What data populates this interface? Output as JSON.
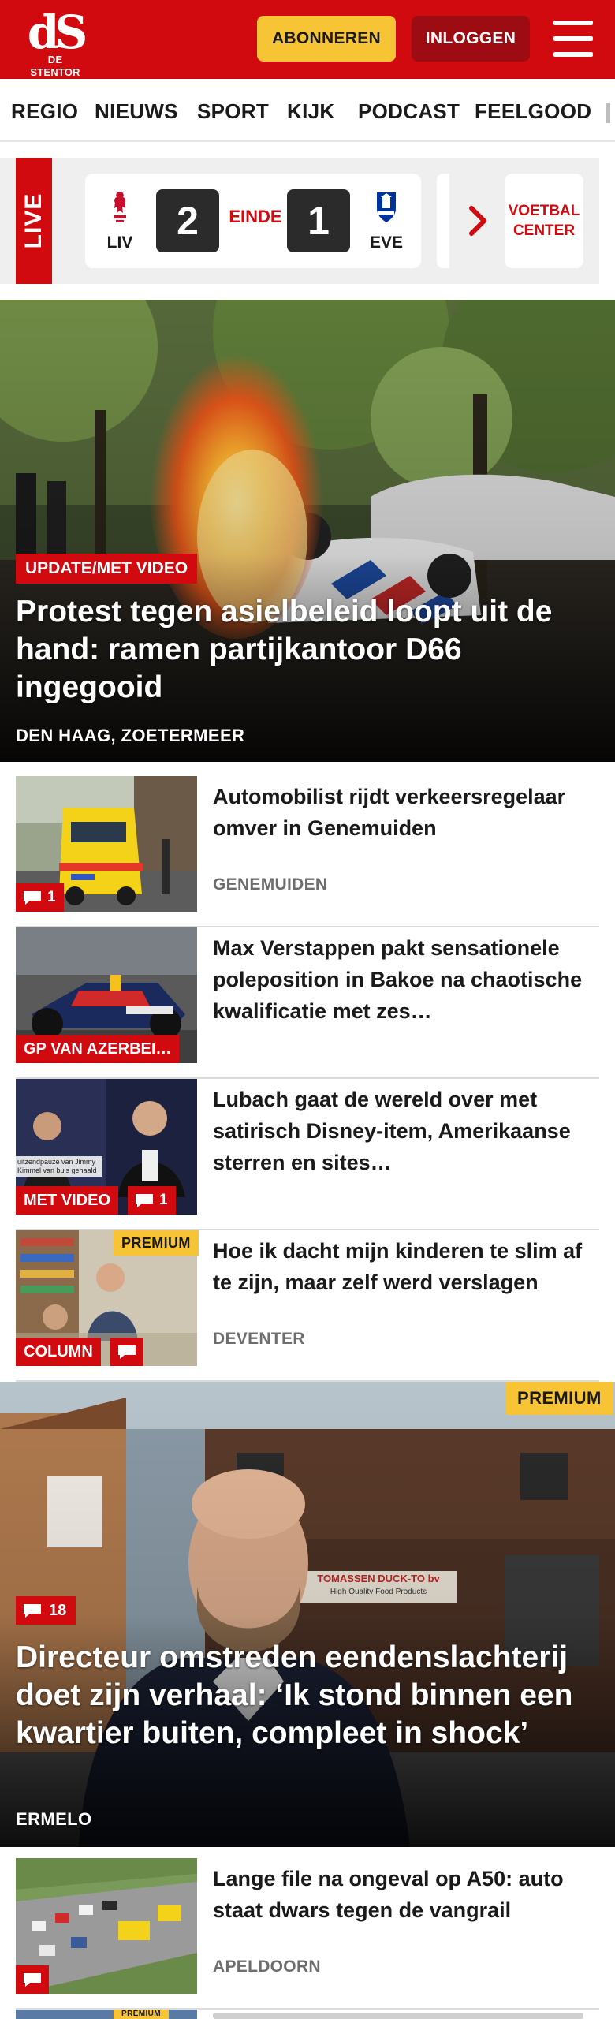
{
  "brand": {
    "mark": "dS",
    "name": "DE STENTOR"
  },
  "header": {
    "subscribe_label": "ABONNEREN",
    "login_label": "INLOGGEN",
    "menu_icon": "hamburger-icon",
    "accent": "#d10a10",
    "subscribe_color": "#f6c435"
  },
  "nav": {
    "items": [
      "REGIO",
      "NIEUWS",
      "SPORT",
      "KIJK",
      "PODCAST",
      "FEELGOOD"
    ]
  },
  "live": {
    "label": "LIVE",
    "match": {
      "home": "LIV",
      "home_score": "2",
      "status": "EINDE",
      "away_score": "1",
      "away": "EVE"
    },
    "center_label": "VOETBAL CENTER"
  },
  "hero": {
    "label": "UPDATE/MET VIDEO",
    "title": "Protest tegen asielbeleid loopt uit de hand: ramen partijkantoor D66 ingegooid",
    "location": "DEN HAAG, ZOETERMEER"
  },
  "articles": [
    {
      "title": "Automobilist rijdt verkeersrege­laar omver in Genemuiden",
      "location": "GENEMUIDEN",
      "comments": "1"
    },
    {
      "title": "Max Verstappen pakt sensatione­le poleposition in Bakoe na chaotische kwalificatie met zes…",
      "tag": "GP VAN AZERBEI…"
    },
    {
      "title": "Lubach gaat de wereld over met satirisch Disney-item, Amerikaanse sterren en sites…",
      "tag": "MET VIDEO",
      "comments": "1",
      "caption": "uitzendpauze van Jimmy Kimmel van buis gehaald"
    },
    {
      "title": "Hoe ik dacht mijn kinderen te slim af te zijn, maar zelf werd verslagen",
      "location": "DEVENTER",
      "tag": "COLUMN",
      "premium": "PREMIUM"
    }
  ],
  "feature": {
    "premium": "PREMIUM",
    "comments": "18",
    "title": "Directeur omstreden eendenslachte­rij doet zijn verhaal: ‘Ik stond binnen een kwartier buiten, compleet in shock’",
    "location": "ERMELO",
    "sign_text": "TOMASSEN DUCK-TO bv",
    "sign_sub": "High Quality Food Products"
  },
  "article5": {
    "title": "Lange file na ongeval op A50: auto staat dwars tegen de vangrail",
    "location": "APELDOORN"
  },
  "article6": {
    "premium": "PREMIUM"
  }
}
